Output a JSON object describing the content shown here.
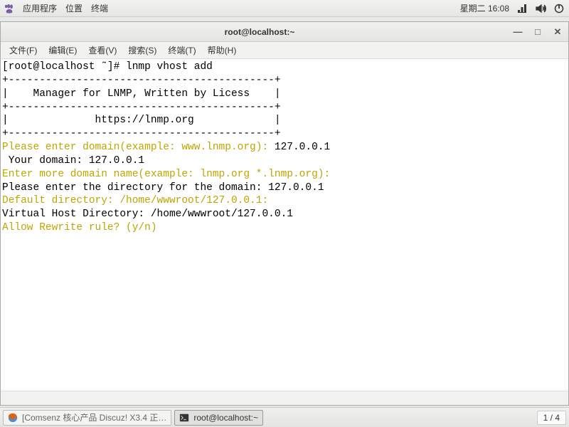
{
  "topbar": {
    "apps": "应用程序",
    "places": "位置",
    "terminal": "终端",
    "date": "星期二 16:08"
  },
  "window": {
    "title": "root@localhost:~"
  },
  "menu": {
    "file": "文件(F)",
    "edit": "编辑(E)",
    "view": "查看(V)",
    "search": "搜索(S)",
    "terminal": "终端(T)",
    "help": "帮助(H)"
  },
  "term": {
    "prompt": "[root@localhost ˜]# ",
    "cmd": "lnmp vhost add",
    "border_top": "+-------------------------------------------+",
    "banner1": "|    Manager for LNMP, Written by Licess    |",
    "border_mid": "+-------------------------------------------+",
    "banner2": "|              https://lnmp.org             |",
    "border_bot": "+-------------------------------------------+",
    "p1a": "Please enter domain(example: www.lnmp.org): ",
    "p1b": "127.0.0.1",
    "p2": " Your domain: 127.0.0.1",
    "p3": "Enter more domain name(example: lnmp.org *.lnmp.org): ",
    "p4a": "Please enter the directory for the domain: ",
    "p4b": "127.0.0.1",
    "p5": "Default directory: /home/wwwroot/127.0.0.1:",
    "p6": "Virtual Host Directory: /home/wwwroot/127.0.0.1",
    "p7": "Allow Rewrite rule? (y/n) "
  },
  "taskbar": {
    "firefox": "[Comsenz 核心产品 Discuz! X3.4 正…",
    "terminal": "root@localhost:~",
    "workspace": "1 / 4"
  }
}
